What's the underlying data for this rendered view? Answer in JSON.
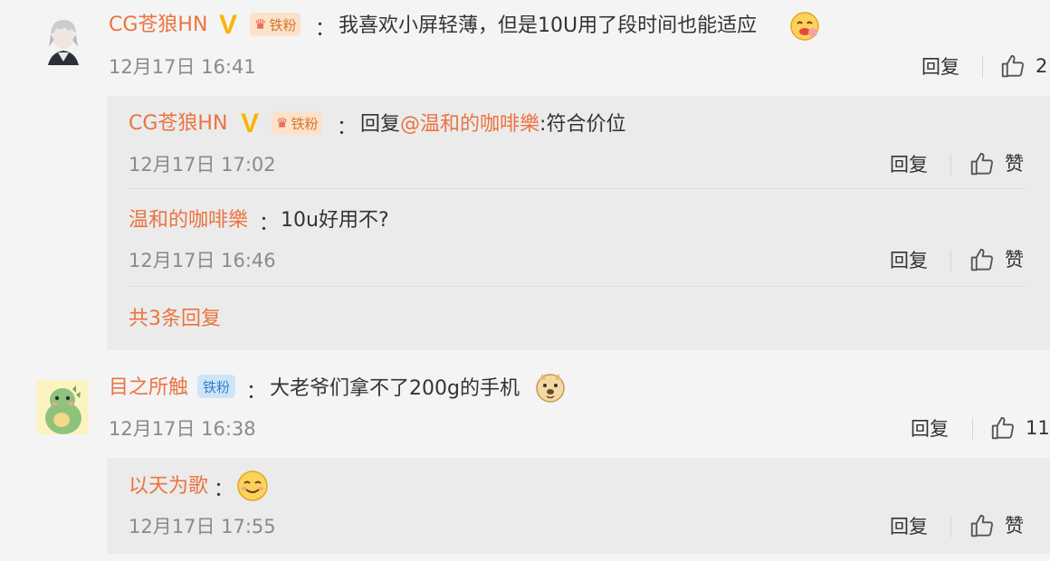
{
  "comments": [
    {
      "user": "CG苍狼HN",
      "fan_label": "铁粉",
      "text": "我喜欢小屏轻薄，但是10U用了段时间也能适应",
      "time": "12月17日 16:41",
      "reply_label": "回复",
      "like_count": "2",
      "replies": [
        {
          "user": "CG苍狼HN",
          "fan_label": "铁粉",
          "reply_prefix": "回复",
          "mention": "@温和的咖啡樂",
          "text": ":符合价位",
          "time": "12月17日 17:02",
          "reply_label": "回复",
          "like_label": "赞"
        },
        {
          "user": "温和的咖啡樂",
          "text": "10u好用不?",
          "time": "12月17日 16:46",
          "reply_label": "回复",
          "like_label": "赞"
        }
      ],
      "more_replies": "共3条回复"
    },
    {
      "user": "目之所触",
      "fan_label": "铁粉",
      "text": "大老爷们拿不了200g的手机",
      "time": "12月17日 16:38",
      "reply_label": "回复",
      "like_count": "11",
      "replies": [
        {
          "user": "以天为歌",
          "time": "12月17日 17:55",
          "reply_label": "回复",
          "like_label": "赞"
        }
      ]
    }
  ],
  "colon": "："
}
